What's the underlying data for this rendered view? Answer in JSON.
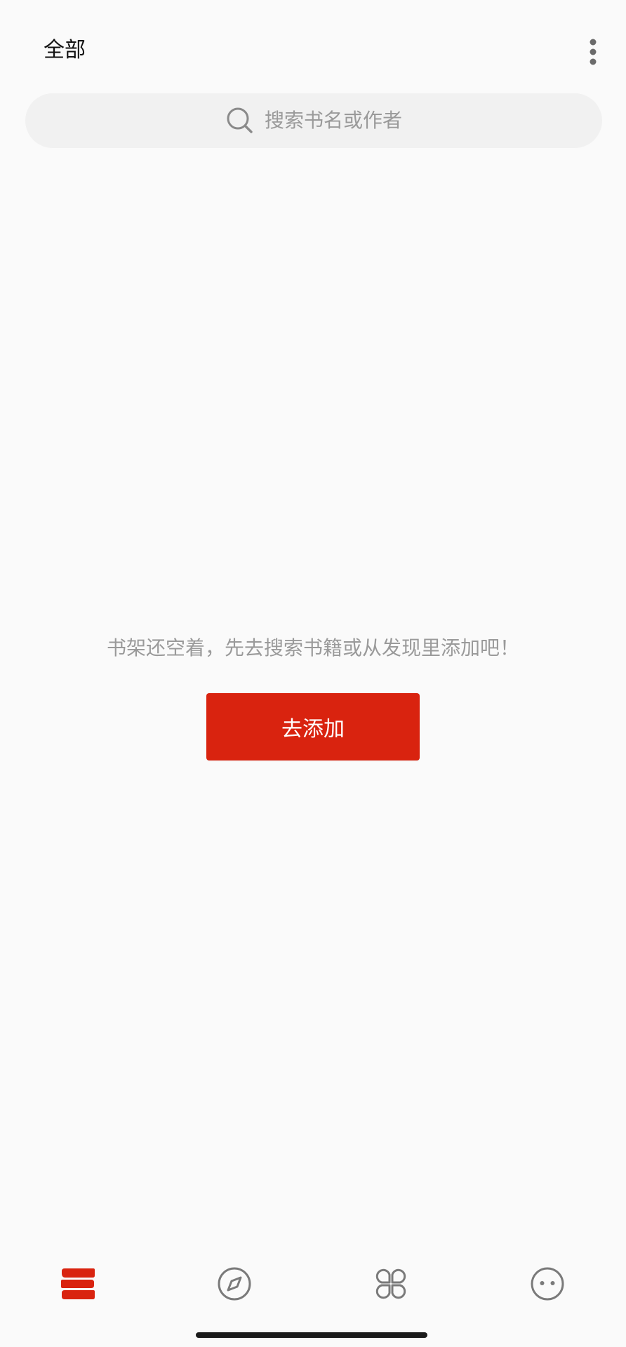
{
  "header": {
    "title": "全部"
  },
  "search": {
    "placeholder": "搜索书名或作者"
  },
  "empty_state": {
    "message": "书架还空着，先去搜索书籍或从发现里添加吧！",
    "button_label": "去添加"
  },
  "bottom_nav": {
    "items": [
      {
        "icon": "bookshelf-icon",
        "active": true
      },
      {
        "icon": "compass-icon",
        "active": false
      },
      {
        "icon": "apps-grid-icon",
        "active": false
      },
      {
        "icon": "smiley-face-icon",
        "active": false
      }
    ]
  },
  "colors": {
    "accent": "#d9230f",
    "background": "#fafafa",
    "search_bg": "#f1f1f1",
    "muted_text": "#9a9a9a",
    "icon_gray": "#7a7a7a"
  }
}
